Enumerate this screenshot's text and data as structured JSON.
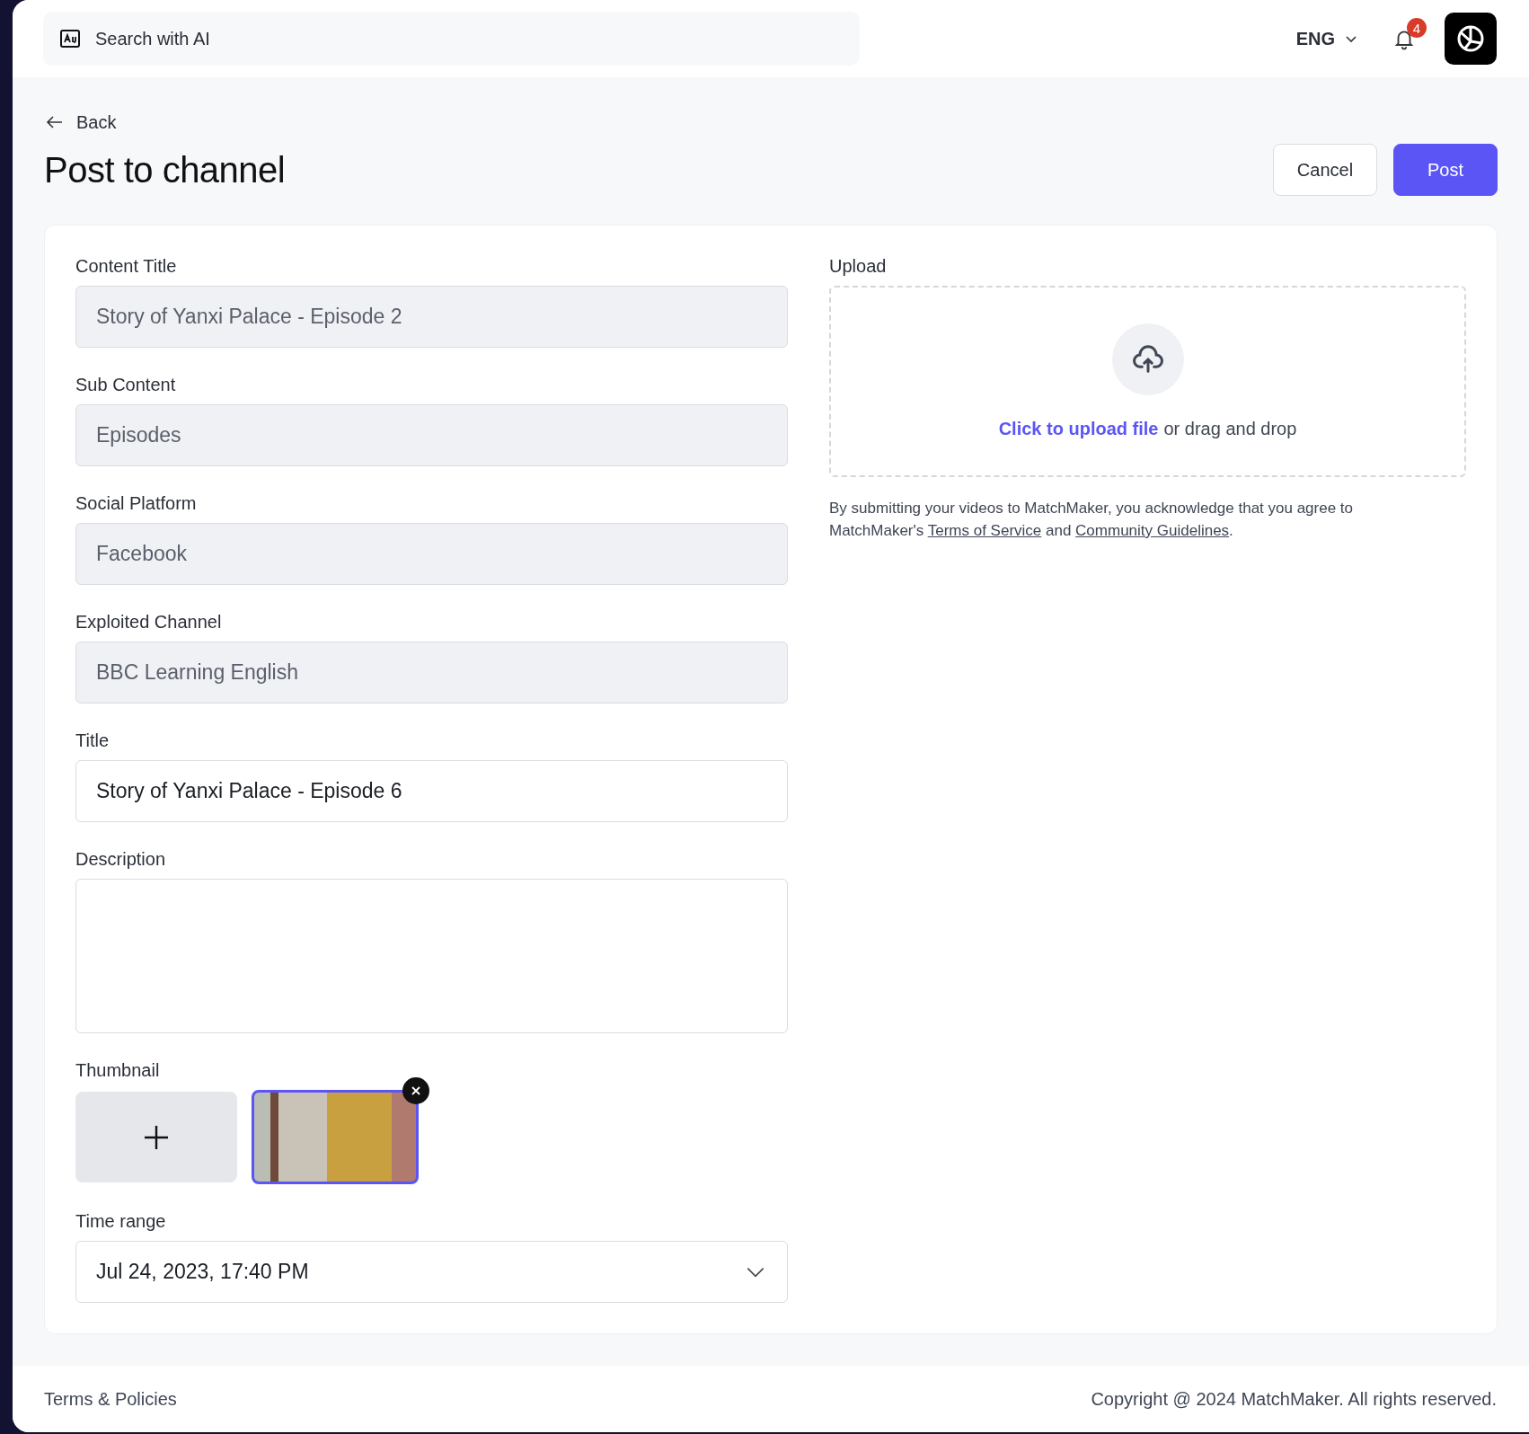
{
  "top_bar": {
    "search": {
      "placeholder": "Search with AI"
    },
    "language": "ENG",
    "notifications": {
      "count": "4"
    }
  },
  "back": "Back",
  "page_title": "Post to channel",
  "actions": [
    {
      "label": "Cancel",
      "kind": "secondary"
    },
    {
      "label": "Post",
      "kind": "primary"
    }
  ],
  "form": {
    "fields": [
      {
        "label": "Content Title",
        "kind": "text",
        "value": "Story of Yanxi Palace - Episode 2",
        "disabled": true
      },
      {
        "label": "Sub Content",
        "kind": "text",
        "value": "Episodes",
        "disabled": true
      },
      {
        "label": "Social Platform",
        "kind": "text",
        "value": "Facebook",
        "disabled": true
      },
      {
        "label": "Exploited Channel",
        "kind": "text",
        "value": "BBC Learning English",
        "disabled": true
      },
      {
        "label": "Title",
        "kind": "text",
        "value": "Story of Yanxi Palace - Episode 6",
        "disabled": false
      },
      {
        "label": "Description",
        "kind": "textarea",
        "disabled": false
      },
      {
        "label": "Thumbnail",
        "kind": "thumbnails",
        "items": [
          {
            "kind": "add",
            "selected": false
          },
          {
            "kind": "image",
            "selected": true
          }
        ]
      },
      {
        "label": "Time range",
        "kind": "select",
        "value": "Jul 24, 2023, 17:40 PM",
        "disabled": false
      }
    ]
  },
  "upload": {
    "label": "Upload",
    "link": "Click to upload file",
    "hint": "or drag and drop",
    "notice": {
      "before": "By submitting your videos to MatchMaker, you acknowledge that you agree to MatchMaker's",
      "link_1": "Terms of Service",
      "middle": "and",
      "link_2": "Community Guidelines",
      "after": "."
    }
  },
  "footer": {
    "left": "Terms & Policies",
    "right": "Copyright @ 2024 MatchMaker. All rights reserved."
  }
}
